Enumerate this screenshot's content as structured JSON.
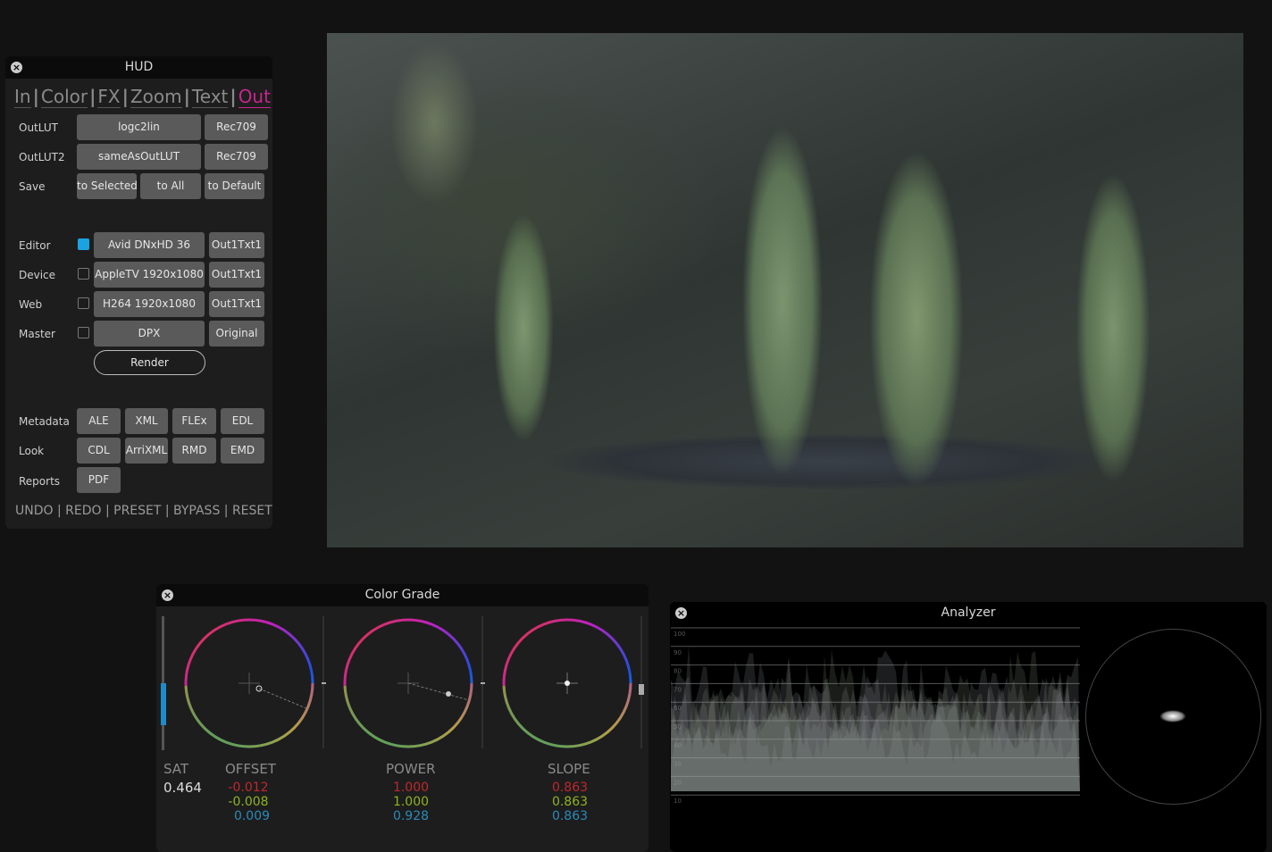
{
  "hud": {
    "title": "HUD",
    "tabs": [
      "In",
      "Color",
      "FX",
      "Zoom",
      "Text",
      "Out"
    ],
    "active_tab": "Out",
    "rows": {
      "outlut": {
        "label": "OutLUT",
        "b1": "logc2lin",
        "b2": "Rec709"
      },
      "outlut2": {
        "label": "OutLUT2",
        "b1": "sameAsOutLUT",
        "b2": "Rec709"
      },
      "save": {
        "label": "Save",
        "b1": "to Selected",
        "b2": "to All",
        "b3": "to Default"
      },
      "editor": {
        "label": "Editor",
        "checked": true,
        "b1": "Avid DNxHD 36",
        "b2": "Out1Txt1"
      },
      "device": {
        "label": "Device",
        "checked": false,
        "b1": "AppleTV 1920x1080",
        "b2": "Out1Txt1"
      },
      "web": {
        "label": "Web",
        "checked": false,
        "b1": "H264 1920x1080",
        "b2": "Out1Txt1"
      },
      "master": {
        "label": "Master",
        "checked": false,
        "b1": "DPX",
        "b2": "Original"
      },
      "render": "Render",
      "metadata": {
        "label": "Metadata",
        "b": [
          "ALE",
          "XML",
          "FLEx",
          "EDL"
        ]
      },
      "look": {
        "label": "Look",
        "b": [
          "CDL",
          "ArriXML",
          "RMD",
          "EMD"
        ]
      },
      "reports": {
        "label": "Reports",
        "b": [
          "PDF"
        ]
      }
    },
    "footer": "UNDO | REDO | PRESET | BYPASS | RESET"
  },
  "color_grade": {
    "title": "Color Grade",
    "sat_label": "SAT",
    "sat": "0.464",
    "saturation_level": 0.464,
    "offset": {
      "label": "OFFSET",
      "r": "-0.012",
      "g": "-0.008",
      "b": "0.009"
    },
    "power": {
      "label": "POWER",
      "r": "1.000",
      "g": "1.000",
      "b": "0.928"
    },
    "slope": {
      "label": "SLOPE",
      "r": "0.863",
      "g": "0.863",
      "b": "0.863"
    }
  },
  "analyzer": {
    "title": "Analyzer",
    "scale": [
      "100",
      "90",
      "80",
      "70",
      "60",
      "50",
      "40",
      "30",
      "20",
      "10"
    ]
  },
  "colors": {
    "accent": "#c8258f",
    "checkbox": "#1aa3e0",
    "red": "#c0282d",
    "green": "#8fb321",
    "blue": "#2a8ab8"
  }
}
